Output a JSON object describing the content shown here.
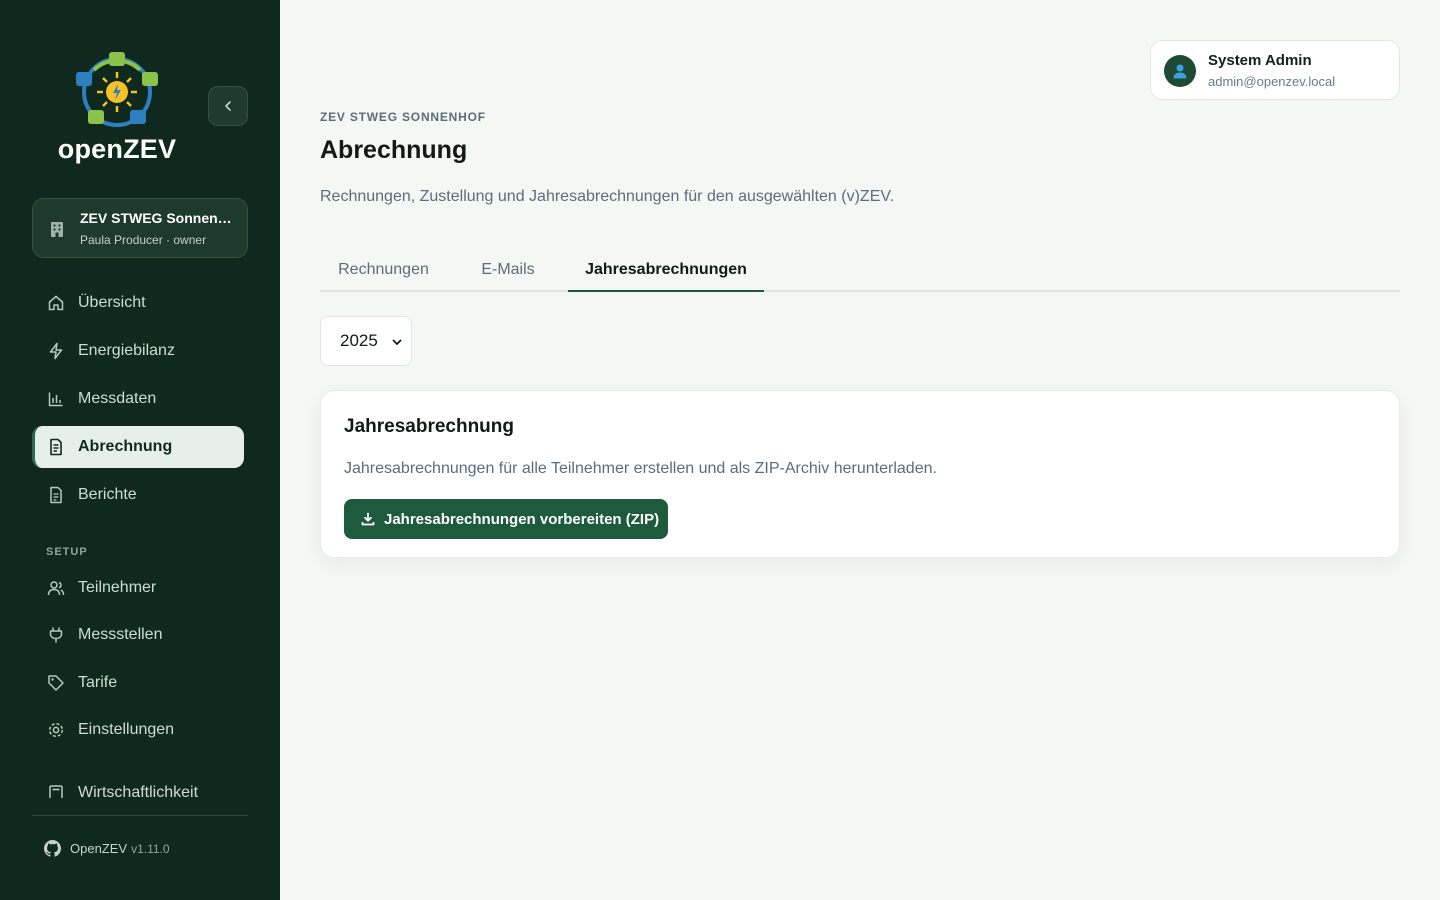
{
  "app": {
    "name": "openZEV"
  },
  "org": {
    "title": "ZEV STWEG Sonnenhof",
    "subtitle": "Paula Producer · owner"
  },
  "nav": {
    "items": [
      {
        "label": "Übersicht",
        "icon": "home-icon"
      },
      {
        "label": "Energiebilanz",
        "icon": "bolt-icon"
      },
      {
        "label": "Messdaten",
        "icon": "bar-chart-icon"
      },
      {
        "label": "Abrechnung",
        "icon": "invoice-icon",
        "active": true
      },
      {
        "label": "Berichte",
        "icon": "document-icon"
      }
    ],
    "section_label": "SETUP",
    "setup_items": [
      {
        "label": "Teilnehmer",
        "icon": "users-icon"
      },
      {
        "label": "Messstellen",
        "icon": "plug-icon"
      },
      {
        "label": "Tarife",
        "icon": "tag-icon"
      },
      {
        "label": "Einstellungen",
        "icon": "settings-icon"
      },
      {
        "label": "Wirtschaftlichkeit",
        "icon": "calculator-icon"
      }
    ]
  },
  "footer": {
    "label": "OpenZEV",
    "version": "v1.11.0"
  },
  "user": {
    "name": "System Admin",
    "email": "admin@openzev.local"
  },
  "header": {
    "eyebrow": "ZEV STWEG SONNENHOF",
    "title": "Abrechnung",
    "description": "Rechnungen, Zustellung und Jahresabrechnungen für den ausgewählten (v)ZEV."
  },
  "tabs": [
    {
      "label": "Rechnungen"
    },
    {
      "label": "E-Mails"
    },
    {
      "label": "Jahresabrechnungen",
      "active": true
    }
  ],
  "year_select": {
    "value": "2025"
  },
  "card": {
    "title": "Jahresabrechnung",
    "description": "Jahresabrechnungen für alle Teilnehmer erstellen und als ZIP-Archiv herunterladen.",
    "button_label": "Jahresabrechnungen vorbereiten (ZIP)"
  },
  "colors": {
    "sidebar": "#10291e",
    "accent": "#1e5a3e",
    "background": "#f5f7f5"
  }
}
